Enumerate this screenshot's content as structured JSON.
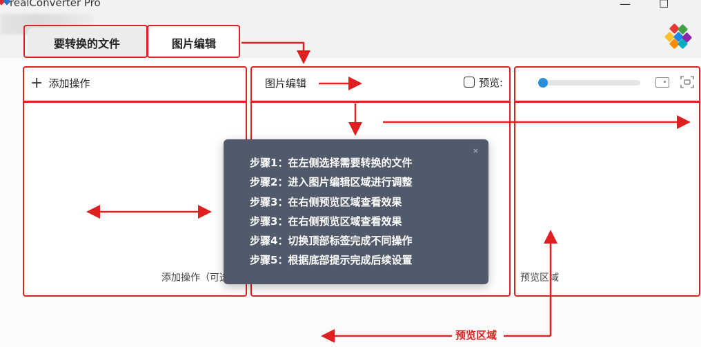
{
  "window": {
    "title": "realConverter Pro",
    "minimize_glyph": "—",
    "maximize_glyph": "☐"
  },
  "tabs": [
    {
      "label": "要转换的文件",
      "active": false
    },
    {
      "label": "图片编辑",
      "active": true
    }
  ],
  "left_panel": {
    "plus_glyph": "+",
    "header": "添加操作",
    "footer": "添加操作（可选)"
  },
  "mid_panel": {
    "header": "图片编辑",
    "preview_label": "预览:",
    "preview_checked": false
  },
  "right_panel": {
    "footer": "预览区域",
    "zoom_level": 0
  },
  "tooltip": {
    "close_glyph": "×",
    "steps": [
      "步骤1：在左侧选择需要转换的文件",
      "步骤2：进入图片编辑区域进行调整",
      "步骤3：在右侧预览区域查看效果",
      "步骤3：在右侧预览区域查看效果",
      "步骤4：切换顶部标签完成不同操作",
      "步骤5：根据底部提示完成后续设置"
    ]
  },
  "annotation": {
    "bottom_label": "预览区域",
    "color": "#e02020"
  },
  "colors": {
    "accent": "#2b8fd6",
    "tooltip_bg": "#515a6a"
  },
  "icons": {
    "app_logo": "app-logo-icon",
    "brand_logo": "brand-logo-icon",
    "add": "plus-icon",
    "fit": "fit-screen-icon",
    "frame": "frame-icon"
  }
}
